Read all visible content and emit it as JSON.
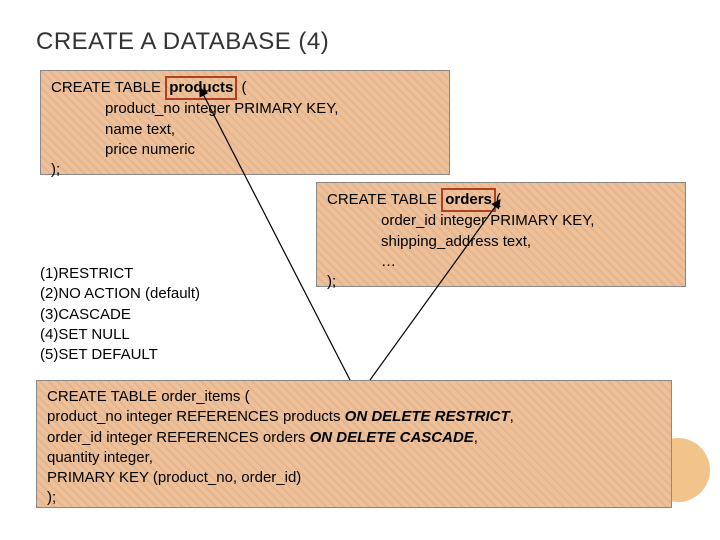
{
  "title": "CREATE A DATABASE (4)",
  "products": {
    "line1_pre": "CREATE TABLE ",
    "line1_key": "products",
    "line1_post": " (",
    "line2": "product_no integer PRIMARY KEY,",
    "line3": "name text,",
    "line4": "price numeric",
    "line5": ");"
  },
  "orders": {
    "line1_pre": "CREATE TABLE ",
    "line1_key": "orders",
    "line1_post": "(",
    "line2": "order_id integer PRIMARY KEY,",
    "line3": "shipping_address text,",
    "line4": "…",
    "line5": ");"
  },
  "options": {
    "opt1": "(1)RESTRICT",
    "opt2": "(2)NO ACTION (default)",
    "opt3": "(3)CASCADE",
    "opt4": "(4)SET NULL",
    "opt5": "(5)SET DEFAULT"
  },
  "orderitems": {
    "line1": "CREATE TABLE order_items (",
    "line2a": "product_no integer REFERENCES products ",
    "line2b": "ON DELETE RESTRICT",
    "line2c": ",",
    "line3a": "order_id integer REFERENCES orders ",
    "line3b": "ON DELETE CASCADE",
    "line3c": ",",
    "line4": "quantity integer,",
    "line5": "PRIMARY KEY (product_no, order_id)",
    "line6": ");"
  }
}
